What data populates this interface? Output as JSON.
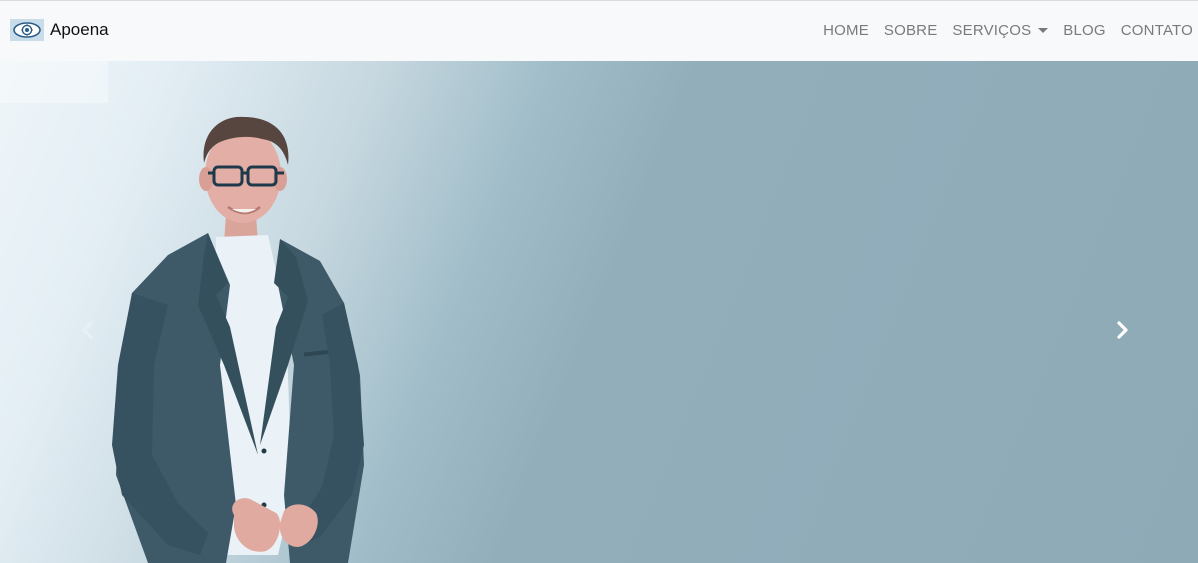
{
  "navbar": {
    "brand": {
      "name": "Apoena",
      "logo_icon": "eye-gear-icon"
    },
    "links": [
      {
        "label": "HOME"
      },
      {
        "label": "SOBRE"
      },
      {
        "label": "SERVIÇOS",
        "dropdown": true
      },
      {
        "label": "BLOG"
      },
      {
        "label": "CONTATO"
      }
    ]
  },
  "hero": {
    "image": "portrait-man-in-suit",
    "prev_icon": "chevron-left-icon",
    "next_icon": "chevron-right-icon"
  },
  "colors": {
    "navbar_bg": "#f8f9fa",
    "nav_text": "#7a7a7a",
    "hero_bg": "#8faab7",
    "suit": "#3f5d6b"
  }
}
